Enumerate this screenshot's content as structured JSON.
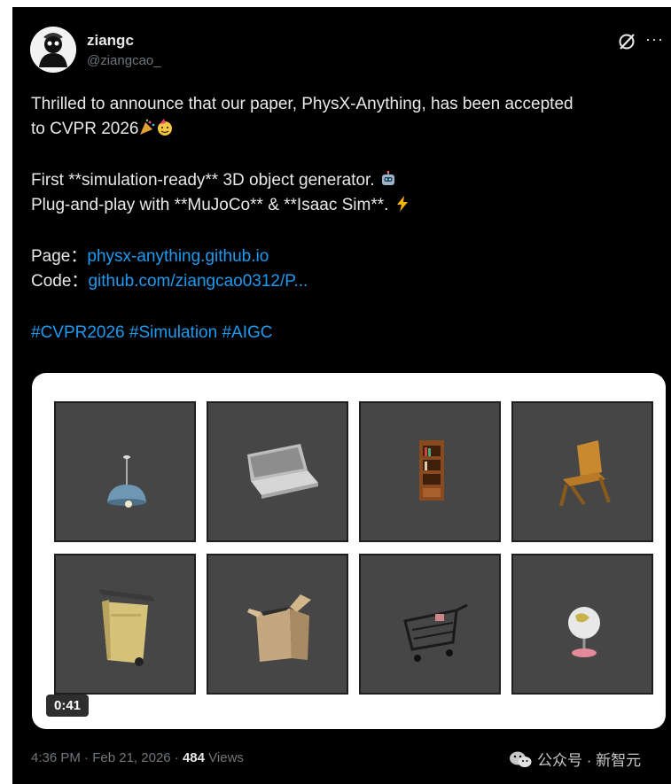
{
  "post": {
    "author": {
      "display_name": "ziangc",
      "handle": "@ziangcao_"
    },
    "text": {
      "line1": "Thrilled to announce that our paper, PhysX-Anything, has been accepted",
      "line2": "to CVPR 2026",
      "line3": "First **simulation-ready** 3D object generator.",
      "line4": "Plug-and-play with **MuJoCo** & **Isaac Sim**.",
      "page_label": "Page：",
      "page_link": "physx-anything.github.io",
      "code_label": "Code：",
      "code_link": "github.com/ziangcao0312/P...",
      "hashtags": "#CVPR2026 #Simulation #AIGC"
    },
    "media": {
      "duration": "0:41",
      "tiles": [
        "lamp",
        "laptop",
        "bookshelf",
        "chair",
        "trash-bin",
        "cardboard-box",
        "shopping-cart",
        "globe"
      ]
    },
    "meta": {
      "time": "4:36 PM",
      "separator": "·",
      "date": "Feb 21, 2026",
      "views_count": "484",
      "views_label": "Views"
    },
    "watermark": "公众号 · 新智元"
  },
  "colors": {
    "background": "#000000",
    "text": "#e7e9ea",
    "muted": "#71767b",
    "link": "#1d9bf0",
    "tile": "#464646"
  }
}
